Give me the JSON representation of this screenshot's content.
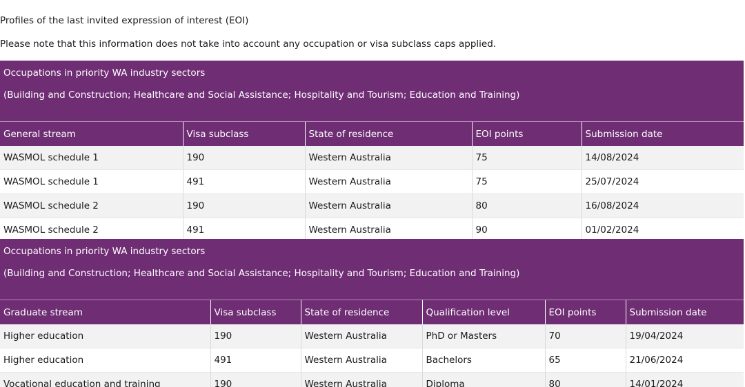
{
  "intro": {
    "line1": "Profiles of the last invited expression of interest (EOI)",
    "line2": "Please note that this information does not take into account any occupation or visa subclass caps applied."
  },
  "general": {
    "sector_title": "Occupations in priority WA industry sectors",
    "sector_subtitle": "(Building and Construction; Healthcare and Social Assistance; Hospitality and Tourism; Education and Training)",
    "headers": [
      "General stream",
      "Visa subclass",
      "State of residence",
      "EOI points",
      "Submission date"
    ],
    "rows": [
      [
        "WASMOL schedule 1",
        "190",
        "Western Australia",
        "75",
        "14/08/2024"
      ],
      [
        "WASMOL schedule 1",
        "491",
        "Western Australia",
        "75",
        "25/07/2024"
      ],
      [
        "WASMOL schedule 2",
        "190",
        "Western Australia",
        "80",
        "16/08/2024"
      ],
      [
        "WASMOL schedule 2",
        "491",
        "Western Australia",
        "90",
        "01/02/2024"
      ]
    ]
  },
  "graduate": {
    "sector_title": "Occupations in priority WA industry sectors",
    "sector_subtitle": "(Building and Construction; Healthcare and Social Assistance; Hospitality and Tourism; Education and Training)",
    "headers": [
      "Graduate stream",
      "Visa subclass",
      "State of residence",
      "Qualification level",
      "EOI points",
      "Submission date"
    ],
    "rows": [
      [
        "Higher education",
        "190",
        "Western Australia",
        "PhD or Masters",
        "70",
        "19/04/2024"
      ],
      [
        "Higher education",
        "491",
        "Western Australia",
        "Bachelors",
        "65",
        "21/06/2024"
      ],
      [
        "Vocational education and training",
        "190",
        "Western Australia",
        "Diploma",
        "80",
        "14/01/2024"
      ]
    ]
  },
  "colors": {
    "header_purple": "#6f2d74",
    "row_stripe": "#f2f2f2"
  }
}
